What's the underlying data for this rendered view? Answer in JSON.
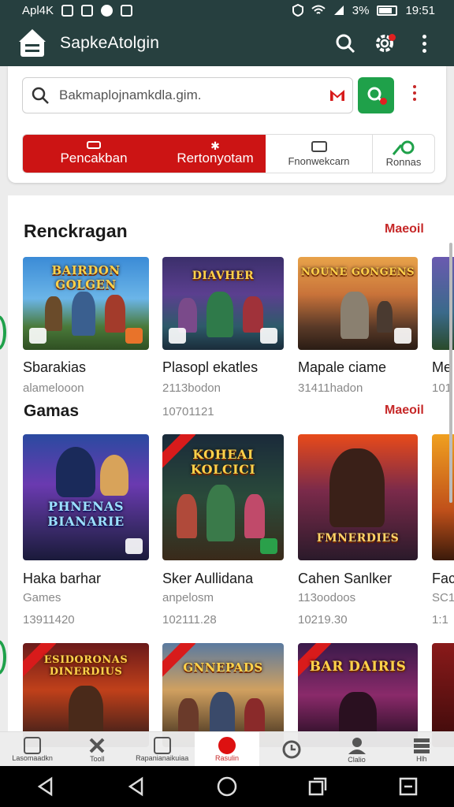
{
  "status_bar": {
    "time": "Apl4K",
    "clock": "19:51",
    "battery": "3%"
  },
  "app_bar": {
    "title": "SapkeAtolgin"
  },
  "search": {
    "value": "Bakmaplojnamkdla.gim."
  },
  "categories": [
    {
      "label": "Pencakban",
      "icon": "tag-icon"
    },
    {
      "label": "Rertonyotam",
      "icon": "star-icon"
    },
    {
      "label": "Fnonwekcarn",
      "icon": "grid-icon"
    },
    {
      "label": "Ronnas",
      "icon": "tool-icon"
    }
  ],
  "section_recommended": {
    "title": "Renckragan",
    "more": "Maeoil",
    "items": [
      {
        "title": "Sbarakias",
        "sub": "alamelooon",
        "logo": "BAIRDON GOLGEN"
      },
      {
        "title": "Plasopl ekatles",
        "sub": "2113bodon",
        "logo": "DIAVHER"
      },
      {
        "title": "Mapale ciame",
        "sub": "31411hadon",
        "logo": "NOUNE GONGENS"
      },
      {
        "title": "Me",
        "sub": "101"
      }
    ]
  },
  "section_games": {
    "title": "Gamas",
    "sub": "10701121",
    "more": "Maeoil",
    "items": [
      {
        "title": "Haka barhar",
        "sub1": "Games",
        "sub2": "13911420",
        "logo": "PHNENAS BIANARIE"
      },
      {
        "title": "Sker Aullidana",
        "sub1": "anpelosm",
        "sub2": "102111.28",
        "logo": "KOHEAI KOLCICI"
      },
      {
        "title": "Cahen Sanlker",
        "sub1": "113oodoos",
        "sub2": "10219.30",
        "logo": "FMNERDIES"
      },
      {
        "title": "Fac",
        "sub1": "SC1",
        "sub2": "1:1"
      }
    ]
  },
  "section_third": {
    "items": [
      {
        "logo": "ESIDORONAS DINERDIUS"
      },
      {
        "logo": "GNNEPADS"
      },
      {
        "logo": "BAR DAIRIS"
      }
    ]
  },
  "tabs": [
    {
      "label": "Lasomaadkn",
      "icon": "home-icon"
    },
    {
      "label": "Tooll",
      "icon": "tools-icon"
    },
    {
      "label": "Rapanianaikuiaa",
      "icon": "apps-icon"
    },
    {
      "label": "Rasulin",
      "icon": "games-icon"
    },
    {
      "label": "",
      "icon": "clock-icon"
    },
    {
      "label": "Clalio",
      "icon": "person-icon"
    },
    {
      "label": "Hlh",
      "icon": "menu-icon"
    }
  ],
  "colors": {
    "app_bar": "#27403f",
    "accent_red": "#cc1414",
    "accent_green": "#1fa14a"
  }
}
